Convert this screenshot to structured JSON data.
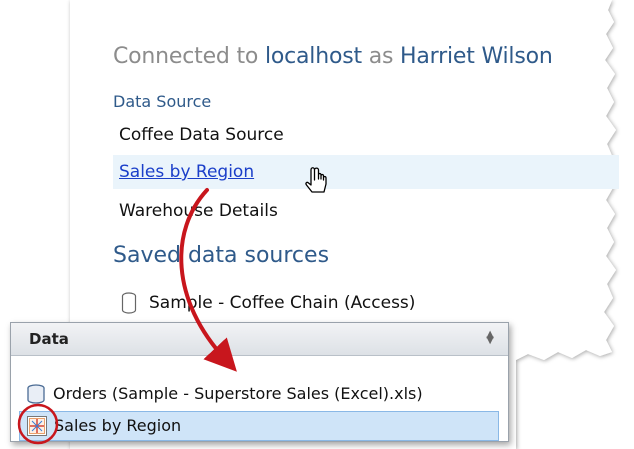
{
  "connection": {
    "prefix": "Connected to",
    "server": "localhost",
    "as_word": "as",
    "user": "Harriet Wilson"
  },
  "data_source": {
    "heading": "Data Source",
    "items": [
      {
        "label": "Coffee Data Source"
      },
      {
        "label": "Sales by Region",
        "hovered": true
      },
      {
        "label": "Warehouse Details"
      }
    ]
  },
  "saved": {
    "heading": "Saved data sources",
    "items": [
      {
        "label": "Sample - Coffee Chain (Access)",
        "icon": "database-cylinder-icon"
      }
    ]
  },
  "data_pane": {
    "title": "Data",
    "rows": [
      {
        "label": "Orders (Sample - Superstore Sales (Excel).xls)",
        "icon": "database-cylinder-icon",
        "selected": false
      },
      {
        "label": "Sales by Region",
        "icon": "published-data-source-icon",
        "selected": true
      }
    ]
  },
  "colors": {
    "accent_blue": "#2f5a8a",
    "link_blue": "#1a3ec9",
    "annotation_red": "#c8161d",
    "selection": "#cfe4f8"
  }
}
